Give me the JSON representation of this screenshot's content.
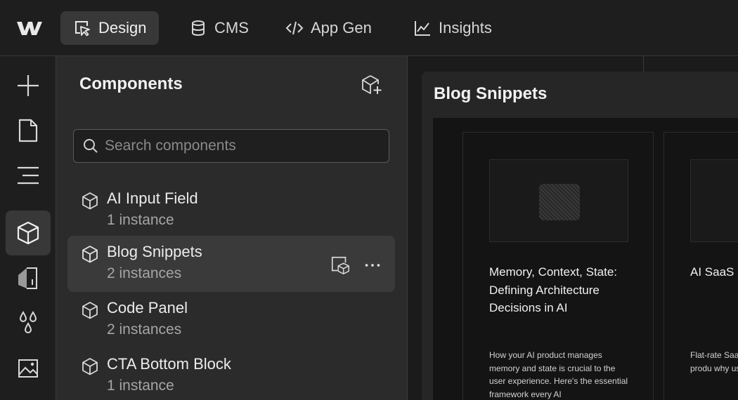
{
  "topbar": {
    "logo_icon": "webflow-logo-icon",
    "tabs": [
      {
        "label": "Design",
        "icon": "cursor-square-icon",
        "active": true
      },
      {
        "label": "CMS",
        "icon": "database-icon",
        "active": false
      },
      {
        "label": "App Gen",
        "icon": "code-icon",
        "active": false
      },
      {
        "label": "Insights",
        "icon": "line-chart-icon",
        "active": false
      }
    ]
  },
  "rail": {
    "items": [
      {
        "icon": "add-icon",
        "active": false
      },
      {
        "icon": "page-icon",
        "active": false
      },
      {
        "icon": "navigator-icon",
        "active": false
      },
      {
        "icon": "component-icon",
        "active": true
      },
      {
        "icon": "style-selectors-icon",
        "active": false
      },
      {
        "icon": "variables-drops-icon",
        "active": false
      },
      {
        "icon": "assets-image-icon",
        "active": false
      }
    ]
  },
  "panel": {
    "title": "Components",
    "new_component_icon": "new-component-icon",
    "search": {
      "placeholder": "Search components",
      "value": ""
    },
    "components": [
      {
        "name": "AI Input Field",
        "count": "1 instance",
        "selected": false
      },
      {
        "name": "Blog Snippets",
        "count": "2 instances",
        "selected": true
      },
      {
        "name": "Code Panel",
        "count": "2 instances",
        "selected": false
      },
      {
        "name": "CTA Bottom Block",
        "count": "1 instance",
        "selected": false
      }
    ]
  },
  "canvas": {
    "frame_title": "Blog Snippets",
    "cards": [
      {
        "title": "Memory, Context, State: Defining Architecture Decisions in AI",
        "description": "How your AI product manages memory and state is crucial to the user experience. Here's the essential framework every AI"
      },
      {
        "title": "AI SaaS Usage-B Win",
        "description": "Flat-rate SaaS sense befor killing produ why usage-b only model"
      }
    ]
  },
  "colors": {
    "background": "#1e1e1e",
    "panel": "#2b2b2b",
    "selected": "#3a3a3a",
    "border": "#3a3a3a",
    "text": "#e6e6e6",
    "muted_text": "#a5a5a5"
  }
}
